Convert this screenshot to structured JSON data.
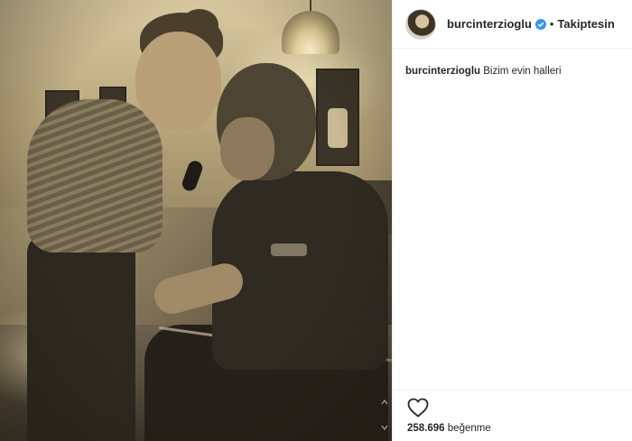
{
  "post": {
    "username": "burcinterzioglu",
    "separator": "•",
    "follow_label": "Takiptesin",
    "caption_user": "burcinterzioglu",
    "caption_text": "Bizim evin halleri",
    "likes_count": "258.696",
    "likes_label": "beğenme"
  },
  "icons": {
    "verified": "verified-badge-icon",
    "like": "heart-icon"
  },
  "colors": {
    "text": "#262626",
    "verified_blue": "#3897f0",
    "divider": "#efefef"
  }
}
